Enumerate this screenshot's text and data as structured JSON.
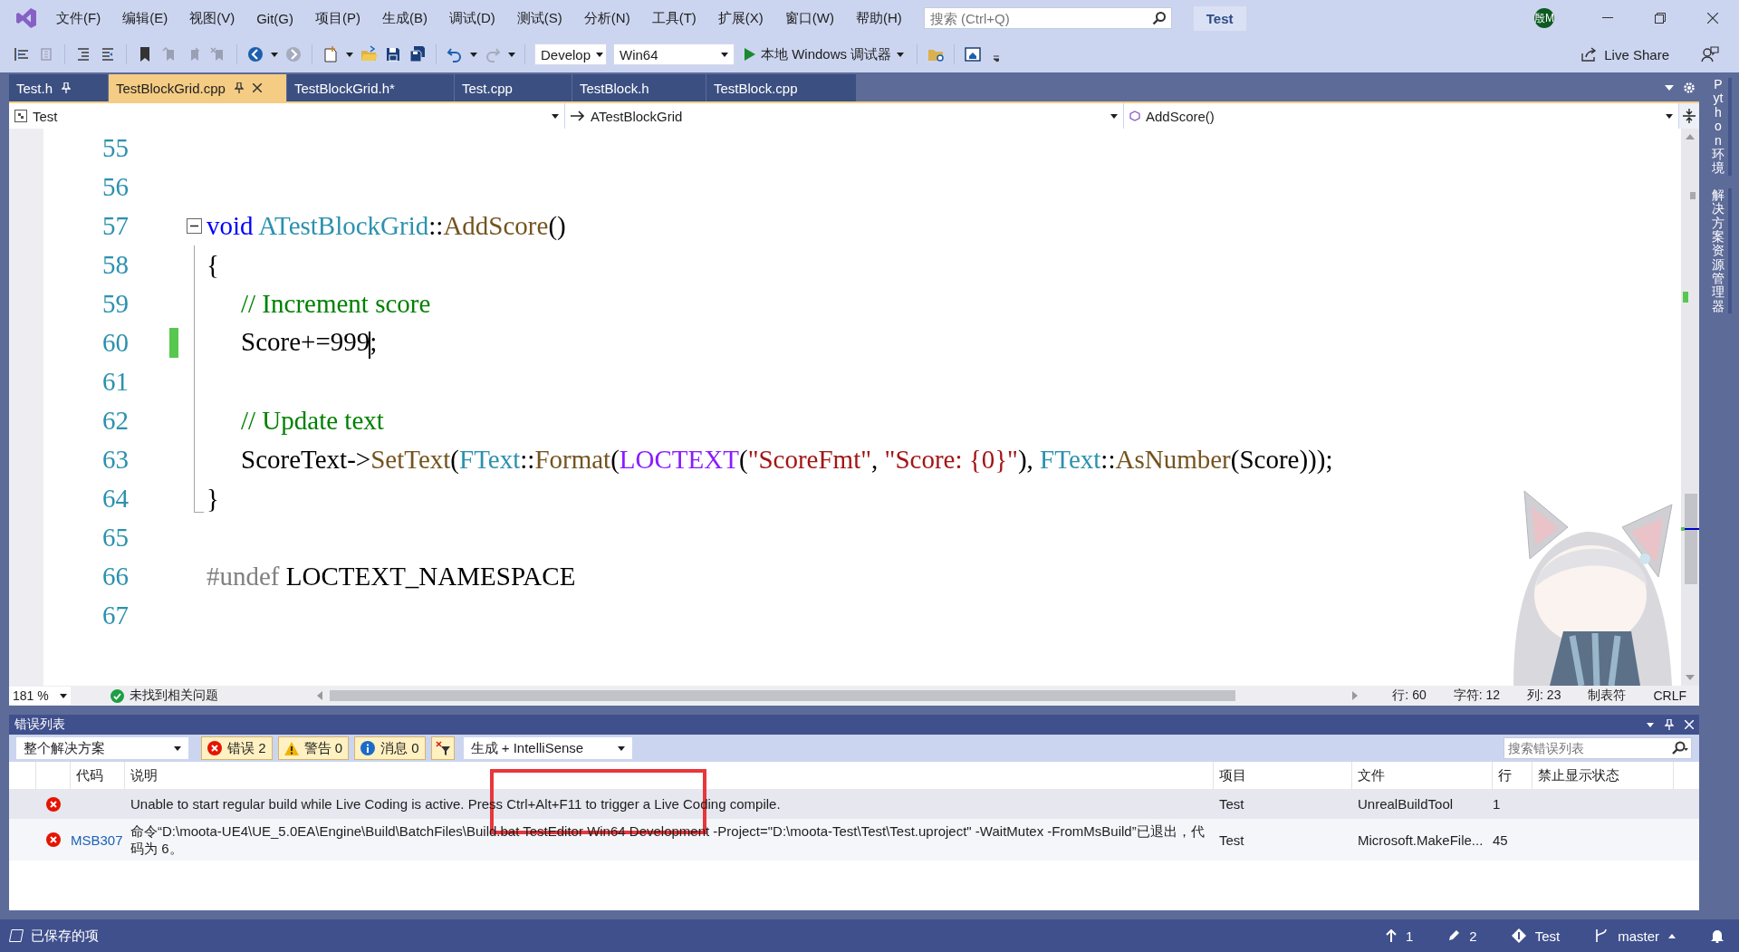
{
  "menu": {
    "items": [
      "文件(F)",
      "编辑(E)",
      "视图(V)",
      "Git(G)",
      "项目(P)",
      "生成(B)",
      "调试(D)",
      "测试(S)",
      "分析(N)",
      "工具(T)",
      "扩展(X)",
      "窗口(W)",
      "帮助(H)"
    ]
  },
  "search": {
    "placeholder": "搜索 (Ctrl+Q)"
  },
  "solution_name": "Test",
  "account": {
    "initials": "殷M"
  },
  "toolbar": {
    "configuration": "Develop",
    "platform": "Win64",
    "run_label": "本地 Windows 调试器",
    "live_share": "Live Share"
  },
  "tabs": [
    {
      "label": "Test.h",
      "selected": false,
      "pinned": true,
      "closable": false
    },
    {
      "label": "TestBlockGrid.cpp",
      "selected": true,
      "pinned": true,
      "closable": true
    },
    {
      "label": "TestBlockGrid.h*",
      "selected": false,
      "pinned": false,
      "closable": false
    },
    {
      "label": "Test.cpp",
      "selected": false,
      "pinned": false,
      "closable": false
    },
    {
      "label": "TestBlock.h",
      "selected": false,
      "pinned": false,
      "closable": false
    },
    {
      "label": "TestBlock.cpp",
      "selected": false,
      "pinned": false,
      "closable": false
    }
  ],
  "navigation": {
    "project": "Test",
    "class": "ATestBlockGrid",
    "member": "AddScore()"
  },
  "editor": {
    "lines": [
      {
        "number": "55",
        "kind": "plain",
        "modified": false
      },
      {
        "number": "56",
        "kind": "plain",
        "modified": false
      },
      {
        "number": "57",
        "kind": "foldstart",
        "modified": false,
        "tokens": [
          {
            "text": "void",
            "kind": "keyword"
          },
          {
            "text": " ATestBlockGrid",
            "kind": "type"
          },
          {
            "text": "::",
            "kind": "plain"
          },
          {
            "text": "AddScore",
            "kind": "function"
          },
          {
            "text": "()",
            "kind": "plain"
          }
        ]
      },
      {
        "number": "58",
        "kind": "foldbody",
        "modified": false,
        "tokens": [
          {
            "text": "{",
            "kind": "plain"
          }
        ]
      },
      {
        "number": "59",
        "kind": "foldbody",
        "modified": false,
        "indented": true,
        "tokens": [
          {
            "text": "// Increment score",
            "kind": "comment"
          }
        ]
      },
      {
        "number": "60",
        "kind": "foldbody",
        "modified": true,
        "indented": true,
        "tokens": [
          {
            "text": "Score+=999",
            "kind": "plain"
          },
          {
            "text": ";",
            "kind": "plain",
            "caret_before": true
          }
        ]
      },
      {
        "number": "61",
        "kind": "foldbody",
        "modified": false
      },
      {
        "number": "62",
        "kind": "foldbody",
        "modified": false,
        "indented": true,
        "tokens": [
          {
            "text": "// Update text",
            "kind": "comment"
          }
        ]
      },
      {
        "number": "63",
        "kind": "foldbody",
        "modified": false,
        "indented": true,
        "tokens": [
          {
            "text": "ScoreText->",
            "kind": "plain"
          },
          {
            "text": "SetText",
            "kind": "function"
          },
          {
            "text": "(",
            "kind": "plain"
          },
          {
            "text": "FText",
            "kind": "type"
          },
          {
            "text": "::",
            "kind": "plain"
          },
          {
            "text": "Format",
            "kind": "function"
          },
          {
            "text": "(",
            "kind": "plain"
          },
          {
            "text": "LOCTEXT",
            "kind": "macro"
          },
          {
            "text": "(",
            "kind": "plain"
          },
          {
            "text": "\"ScoreFmt\"",
            "kind": "string"
          },
          {
            "text": ", ",
            "kind": "plain"
          },
          {
            "text": "\"Score: {0}\"",
            "kind": "string"
          },
          {
            "text": "), ",
            "kind": "plain"
          },
          {
            "text": "FText",
            "kind": "type"
          },
          {
            "text": "::",
            "kind": "plain"
          },
          {
            "text": "AsNumber",
            "kind": "function"
          },
          {
            "text": "(Score)));",
            "kind": "plain"
          }
        ]
      },
      {
        "number": "64",
        "kind": "foldend",
        "modified": false,
        "tokens": [
          {
            "text": "}",
            "kind": "plain"
          }
        ]
      },
      {
        "number": "65",
        "kind": "plain",
        "modified": false
      },
      {
        "number": "66",
        "kind": "plain",
        "modified": false,
        "tokens": [
          {
            "text": "#undef",
            "kind": "preprocessor"
          },
          {
            "text": " LOCTEXT_NAMESPACE",
            "kind": "plain"
          }
        ]
      },
      {
        "number": "67",
        "kind": "plain",
        "modified": false
      }
    ],
    "zoom": "181 %",
    "issues": "未找到相关问题",
    "line": "行: 60",
    "char": "字符: 12",
    "column": "列: 23",
    "indentation": "制表符",
    "line_ending": "CRLF"
  },
  "error_list": {
    "title": "错误列表",
    "scope": "整个解决方案",
    "filters": [
      {
        "kind": "error",
        "label": "错误 2",
        "selected": true
      },
      {
        "kind": "warning",
        "label": "警告 0",
        "selected": true
      },
      {
        "kind": "message",
        "label": "消息 0",
        "selected": true
      }
    ],
    "source": "生成 + IntelliSense",
    "search_placeholder": "搜索错误列表",
    "columns": [
      "代码",
      "说明",
      "项目",
      "文件",
      "行",
      "禁止显示状态"
    ],
    "rows": [
      {
        "kind": "error",
        "selected": true,
        "description": "Unable to start regular build while Live Coding is active. Press Ctrl+Alt+F11 to trigger a Live Coding compile.",
        "project": "Test",
        "file": "UnrealBuildTool",
        "line": "1"
      },
      {
        "kind": "error",
        "selected": false,
        "code": "MSB307",
        "description": "命令“D:\\moota-UE4\\UE_5.0EA\\Engine\\Build\\BatchFiles\\Build.bat TestEditor Win64 Development -Project=\"D:\\moota-Test\\Test\\Test.uproject\" -WaitMutex -FromMsBuild”已退出，代码为 6。",
        "project": "Test",
        "file": "Microsoft.MakeFile...",
        "line": "45"
      }
    ],
    "highlight": {
      "kind": "annotation-box"
    }
  },
  "status_bar": {
    "saved": "已保存的项",
    "pushes": "1",
    "changes": "2",
    "repository": "Test",
    "branch": "master"
  },
  "side_tabs": [
    "Python 环境",
    "解决方案资源管理器"
  ]
}
